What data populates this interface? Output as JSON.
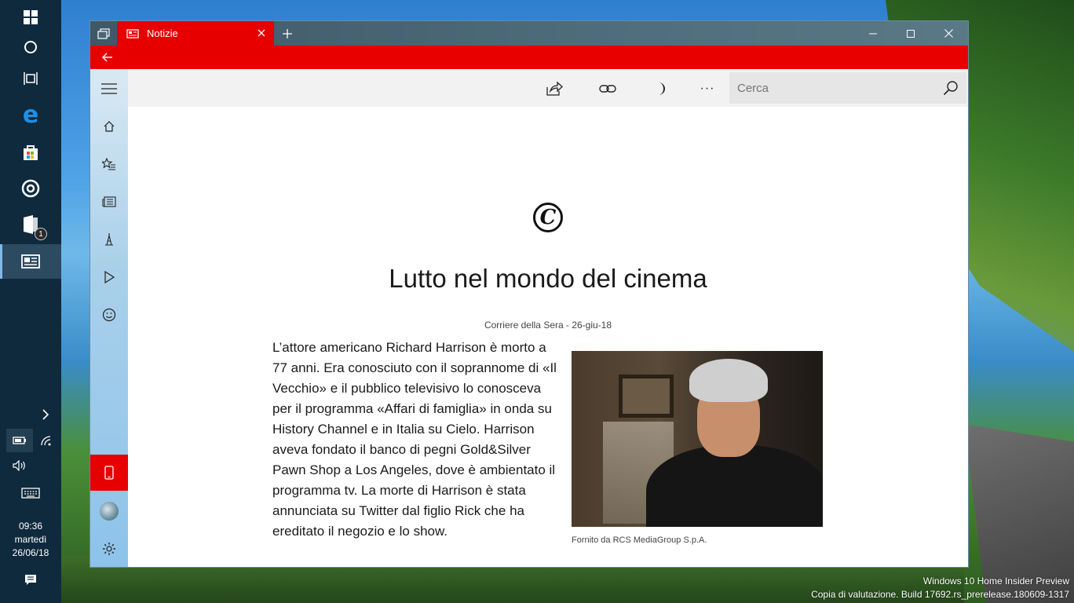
{
  "window": {
    "tab_title": "Notizie",
    "colors": {
      "accent": "#e60000",
      "sidebar": "#8dc3ea"
    }
  },
  "toolbar": {
    "search_placeholder": "Cerca",
    "more_label": "···"
  },
  "article": {
    "headline": "Lutto nel mondo del cinema",
    "byline": "Corriere della Sera - 26-giu-18",
    "publisher_logo_letter": "C",
    "body": "L’attore americano Richard Harrison è morto a 77 anni. Era conosciuto con il soprannome di «Il Vecchio» e il pubblico televisivo lo conosceva per il programma «Affari di famiglia» in onda su History Channel e in Italia su Cielo. Harrison aveva fondato il banco di pegni Gold&Silver Pawn Shop a Los Angeles, dove è ambientato il programma tv. La morte di Harrison è stata annunciata su Twitter dal figlio Rick che ha ereditato il negozio e lo show.",
    "image_caption": "Fornito da RCS MediaGroup S.p.A."
  },
  "taskbar": {
    "notification_badge": "1",
    "time": "09:36",
    "day": "martedì",
    "date": "26/06/18"
  },
  "desktop": {
    "watermark_line1": "Windows 10 Home Insider Preview",
    "watermark_line2": "Copia di valutazione. Build 17692.rs_prerelease.180609-1317"
  }
}
